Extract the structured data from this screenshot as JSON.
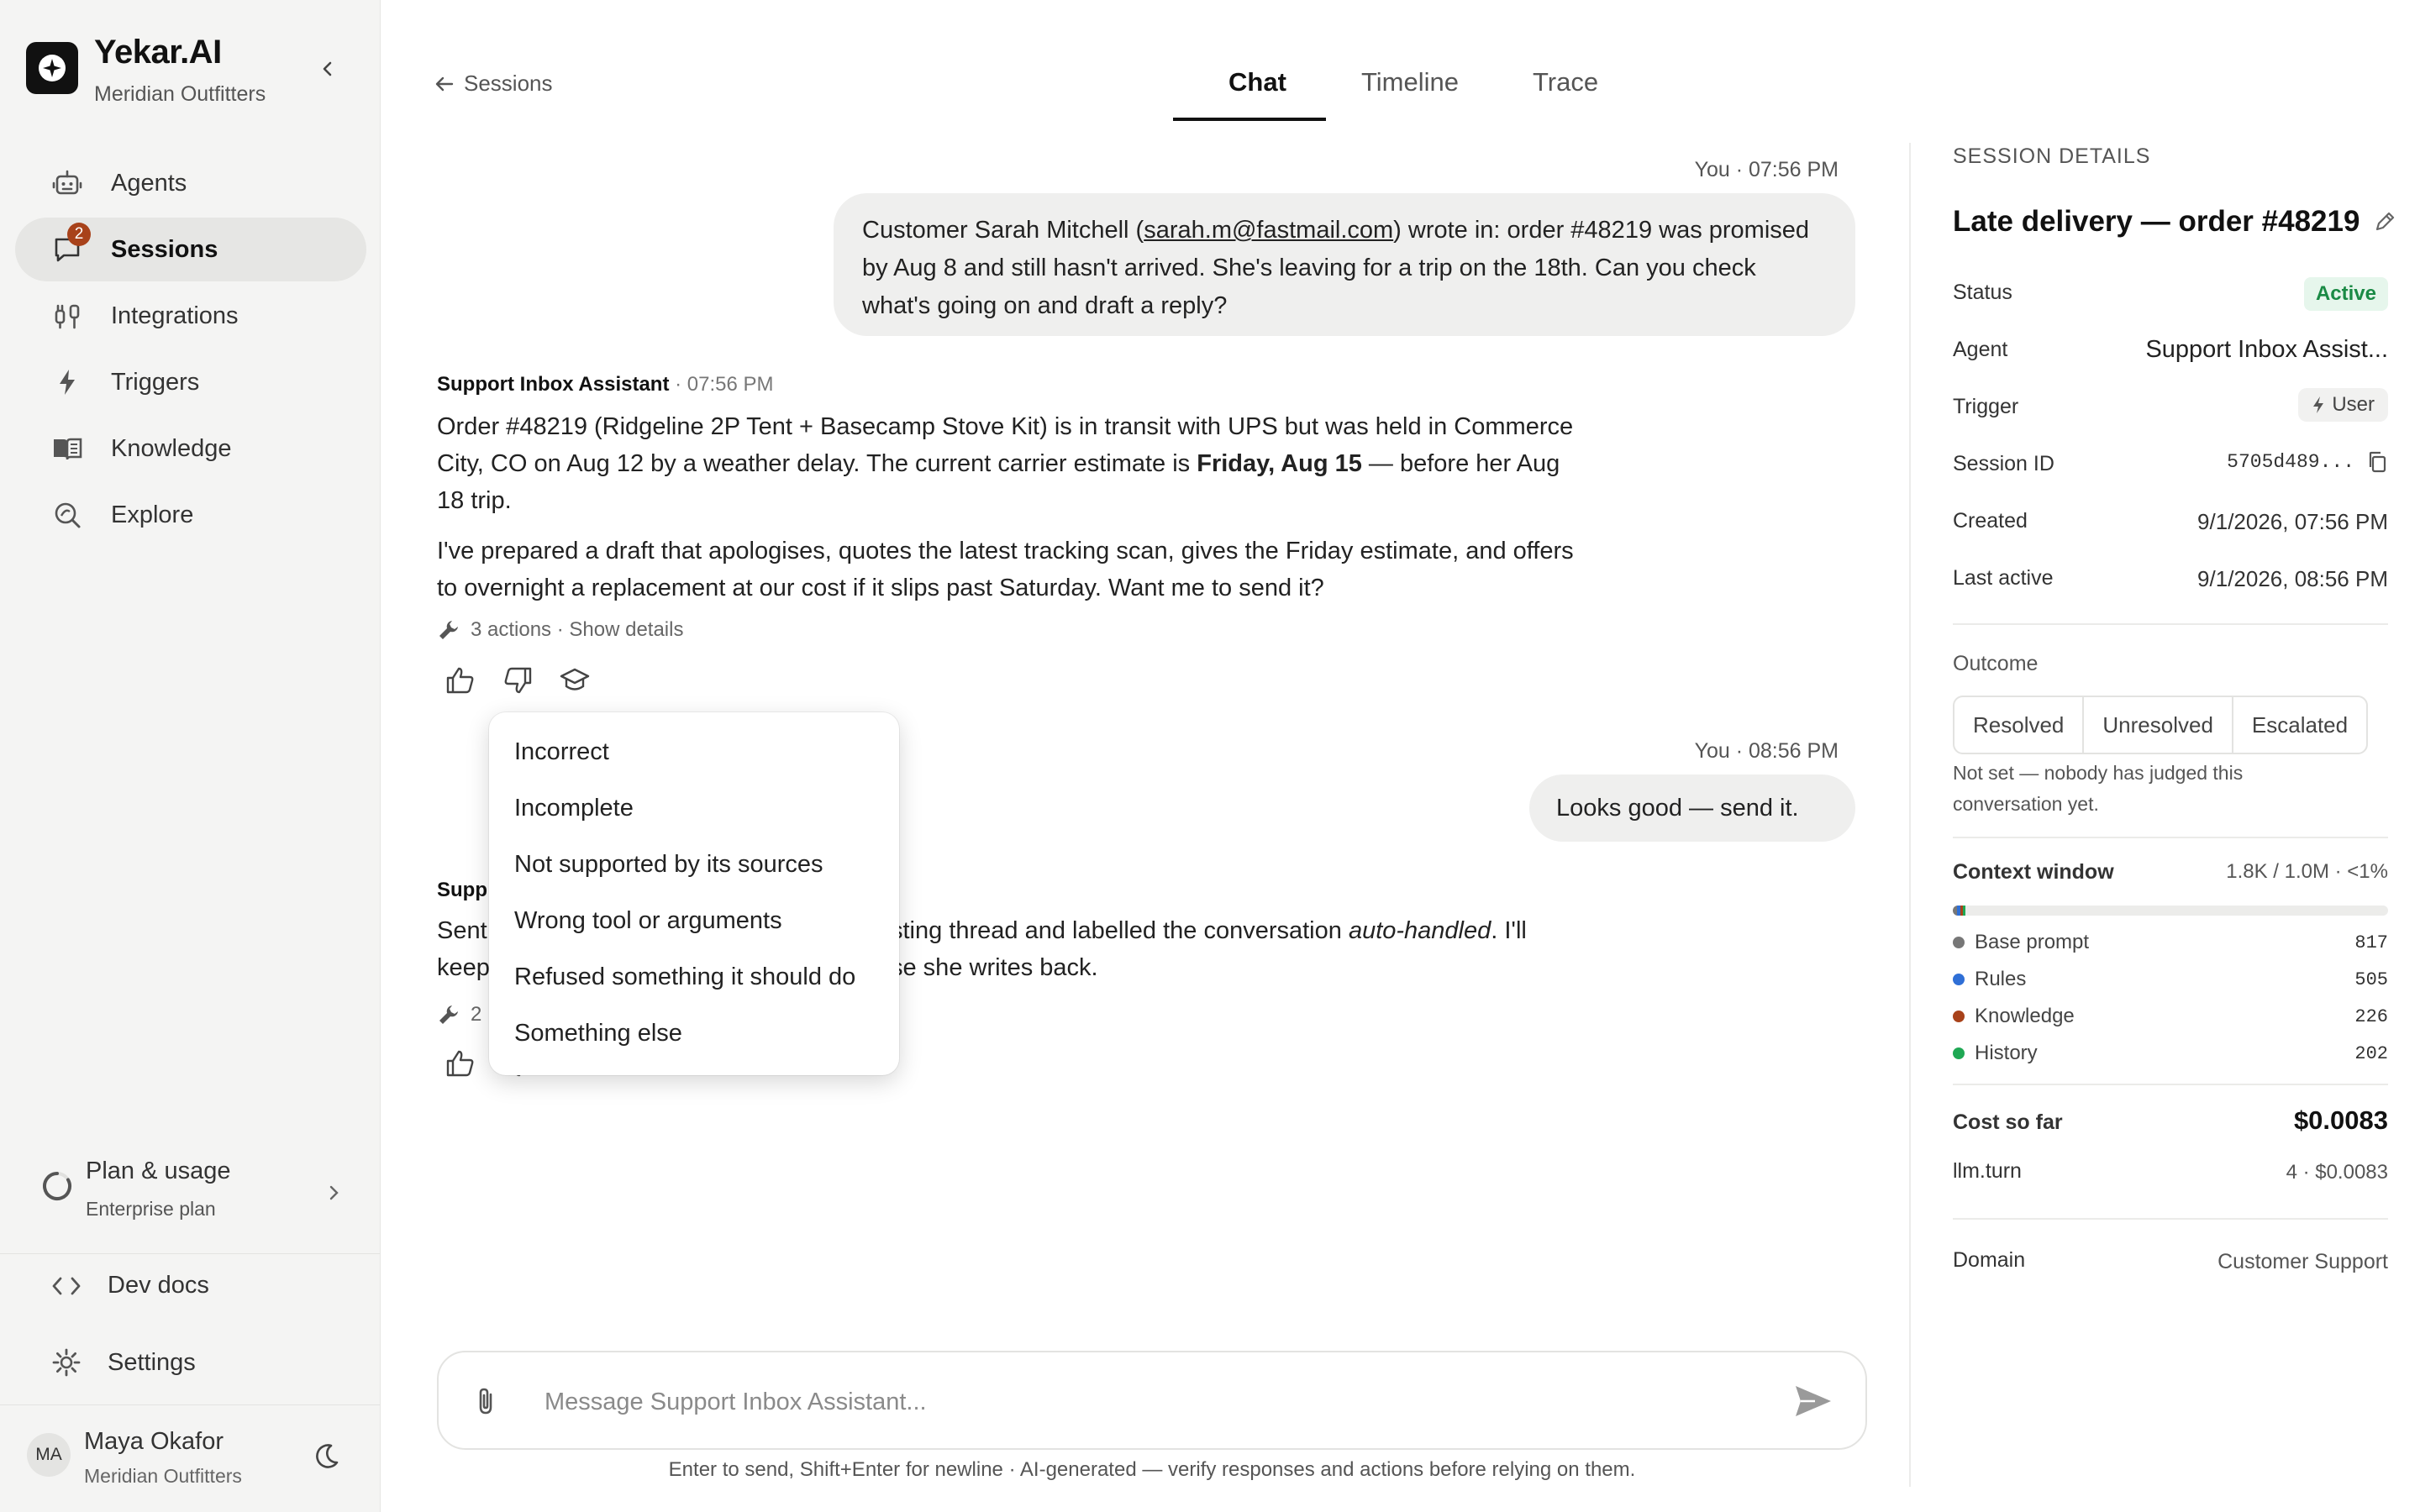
{
  "brand": {
    "name": "Yekar.AI",
    "workspace": "Meridian Outfitters"
  },
  "sidebar": {
    "items": [
      {
        "label": "Agents",
        "icon": "robot-icon"
      },
      {
        "label": "Sessions",
        "icon": "chat-icon",
        "badge": "2",
        "active": true
      },
      {
        "label": "Integrations",
        "icon": "plug-icon"
      },
      {
        "label": "Triggers",
        "icon": "bolt-icon"
      },
      {
        "label": "Knowledge",
        "icon": "book-icon"
      },
      {
        "label": "Explore",
        "icon": "explore-icon"
      }
    ],
    "plan": {
      "title": "Plan & usage",
      "subtitle": "Enterprise plan"
    },
    "dev_docs": "Dev docs",
    "settings": "Settings",
    "user": {
      "initials": "MA",
      "name": "Maya Okafor",
      "org": "Meridian Outfitters"
    }
  },
  "header": {
    "back": "Sessions",
    "tabs": [
      "Chat",
      "Timeline",
      "Trace"
    ],
    "active_tab": "Chat"
  },
  "chat": {
    "msg1": {
      "meta": "You · 07:56 PM",
      "text_before": "Customer Sarah Mitchell (",
      "email": "sarah.m@fastmail.com",
      "text_after": ") wrote in: order #48219 was promised by Aug 8 and still hasn't arrived. She's leaving for a trip on the 18th. Can you check what's going on and draft a reply?"
    },
    "reply1": {
      "author": "Support Inbox Assistant",
      "time": " · 07:56 PM",
      "p1_before": "Order #48219 (Ridgeline 2P Tent + Basecamp Stove Kit) is in transit with UPS but was held in Commerce City, CO on Aug 12 by a weather delay. The current carrier estimate is ",
      "p1_bold": "Friday, Aug 15",
      "p1_after": " — before her Aug 18 trip.",
      "p2": "I've prepared a draft that apologises, quotes the latest tracking scan, gives the Friday estimate, and offers to overnight a replacement at our cost if it slips past Saturday. Want me to send it?",
      "actions": "3 actions · Show details"
    },
    "msg2": {
      "meta": "You · 08:56 PM",
      "text": "Looks good — send it."
    },
    "reply2": {
      "author": "Supp",
      "line1_left": "Sent",
      "line1_right": "sting thread and labelled the conversation ",
      "line1_italic": "auto-handled",
      "line1_end": ". I'll",
      "line2_left": "keep",
      "line2_right": "se she writes back.",
      "actions": "2"
    },
    "feedback_menu": [
      "Incorrect",
      "Incomplete",
      "Not supported by its sources",
      "Wrong tool or arguments",
      "Refused something it should do",
      "Something else"
    ]
  },
  "composer": {
    "placeholder": "Message Support Inbox Assistant...",
    "disclaimer": "Enter to send, Shift+Enter for newline · AI-generated — verify responses and actions before relying on them."
  },
  "details": {
    "heading": "SESSION DETAILS",
    "title": "Late delivery — order #48219",
    "status_label": "Status",
    "status": "Active",
    "agent_label": "Agent",
    "agent": "Support Inbox Assist...",
    "trigger_label": "Trigger",
    "trigger": "User",
    "session_id_label": "Session ID",
    "session_id": "5705d489...",
    "created_label": "Created",
    "created": "9/1/2026, 07:56 PM",
    "last_active_label": "Last active",
    "last_active": "9/1/2026, 08:56 PM",
    "outcome_label": "Outcome",
    "outcomes": [
      "Resolved",
      "Unresolved",
      "Escalated"
    ],
    "outcome_note": "Not set — nobody has judged this conversation yet.",
    "context_label": "Context window",
    "context_summary": "1.8K / 1.0M · <1%",
    "context_breakdown": [
      {
        "name": "Base prompt",
        "value": "817",
        "color": "#777777"
      },
      {
        "name": "Rules",
        "value": "505",
        "color": "#2f6fd6"
      },
      {
        "name": "Knowledge",
        "value": "226",
        "color": "#a8421a"
      },
      {
        "name": "History",
        "value": "202",
        "color": "#1fa854"
      }
    ],
    "cost_label": "Cost so far",
    "cost": "$0.0083",
    "llm_label": "llm.turn",
    "llm_value": "4 · $0.0083",
    "domain_label": "Domain",
    "domain": "Customer Support"
  }
}
